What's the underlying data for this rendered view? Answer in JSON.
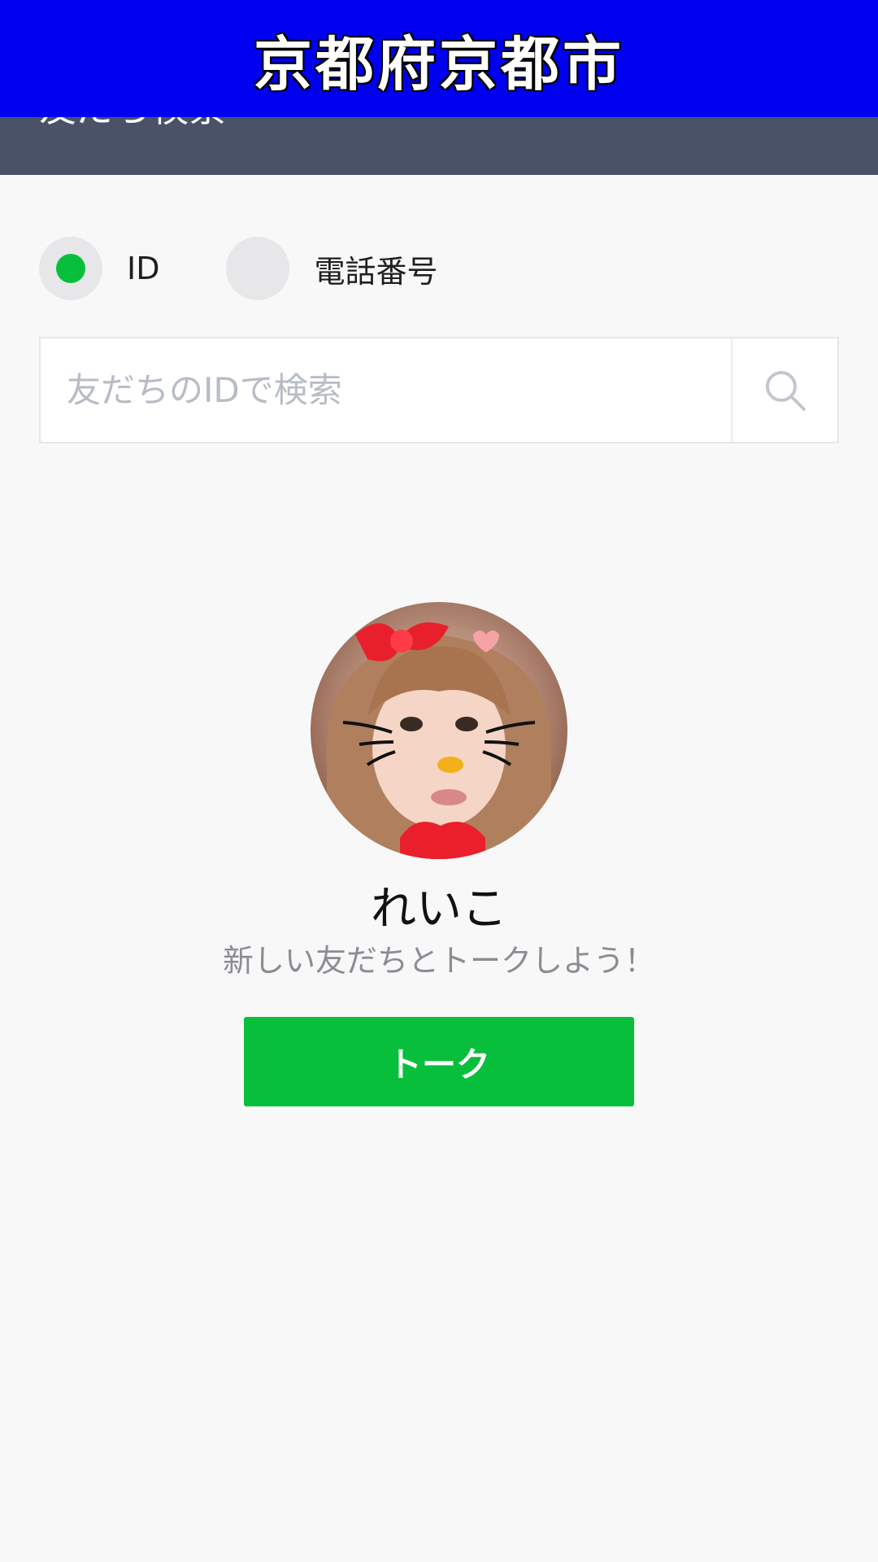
{
  "banner": {
    "text": "京都府京都市"
  },
  "header": {
    "title": "友だち検索"
  },
  "search_type": {
    "options": [
      {
        "label": "ID",
        "selected": true
      },
      {
        "label": "電話番号",
        "selected": false
      }
    ]
  },
  "search": {
    "placeholder": "友だちのIDで検索",
    "value": ""
  },
  "profile": {
    "name": "れいこ",
    "subtitle": "新しい友だちとトークしよう！",
    "action_label": "トーク"
  },
  "colors": {
    "accent_green": "#08bf3c",
    "header_bg": "#4a5268",
    "banner_bg": "#0000f0"
  }
}
